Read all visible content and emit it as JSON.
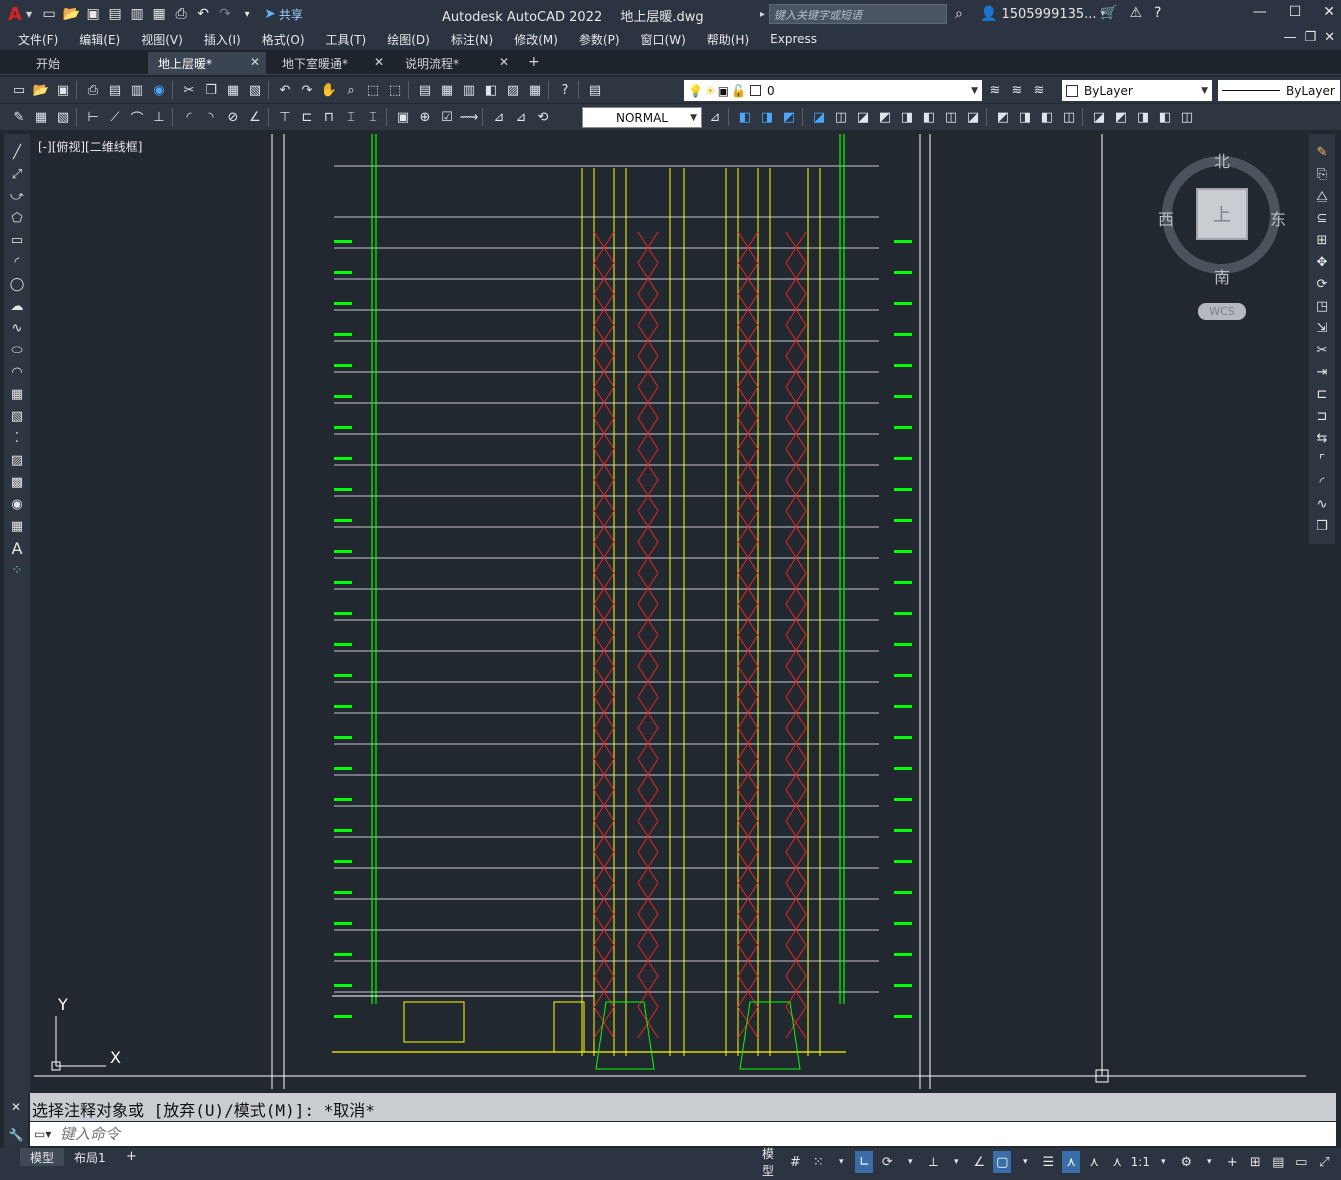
{
  "app": {
    "logo": "A",
    "share_label": "共享",
    "title": "Autodesk AutoCAD 2022",
    "file_name": "地上层暖.dwg",
    "search_placeholder": "键入关键字或短语",
    "user_name": "1505999135...",
    "quick_access_icons": [
      "new-icon",
      "open-icon",
      "save-icon",
      "save-as-icon",
      "open-web-icon",
      "save-web-icon",
      "plot-icon",
      "undo-icon",
      "redo-icon",
      "customize-icon"
    ]
  },
  "menubar": {
    "items": [
      "文件(F)",
      "编辑(E)",
      "视图(V)",
      "插入(I)",
      "格式(O)",
      "工具(T)",
      "绘图(D)",
      "标注(N)",
      "修改(M)",
      "参数(P)",
      "窗口(W)",
      "帮助(H)",
      "Express"
    ]
  },
  "tabs": [
    {
      "label": "开始",
      "closable": false
    },
    {
      "label": "地上层暖*",
      "closable": true,
      "active": true
    },
    {
      "label": "地下室暖通*",
      "closable": true
    },
    {
      "label": "说明流程*",
      "closable": true
    }
  ],
  "properties": {
    "layer_name": "0",
    "color": "ByLayer",
    "linetype": "ByLayer",
    "text_style": "NORMAL"
  },
  "viewport": {
    "label": "[-][俯视][二维线框]"
  },
  "viewcube": {
    "north": "北",
    "south": "南",
    "east": "东",
    "west": "西",
    "face": "上",
    "wcs": "WCS"
  },
  "ucs": {
    "x": "X",
    "y": "Y"
  },
  "command": {
    "history": "选择注释对象或 [放弃(U)/模式(M)]: *取消*",
    "placeholder": "键入命令"
  },
  "status": {
    "layouts": [
      "模型",
      "布局1"
    ],
    "model_label": "模型",
    "scale": "1:1"
  },
  "colors": {
    "background": "#212830",
    "pipe_green": "#00ff00",
    "pipe_yellow": "#ffff00",
    "pipe_red": "#ff2020",
    "line_white": "#ffffff"
  }
}
